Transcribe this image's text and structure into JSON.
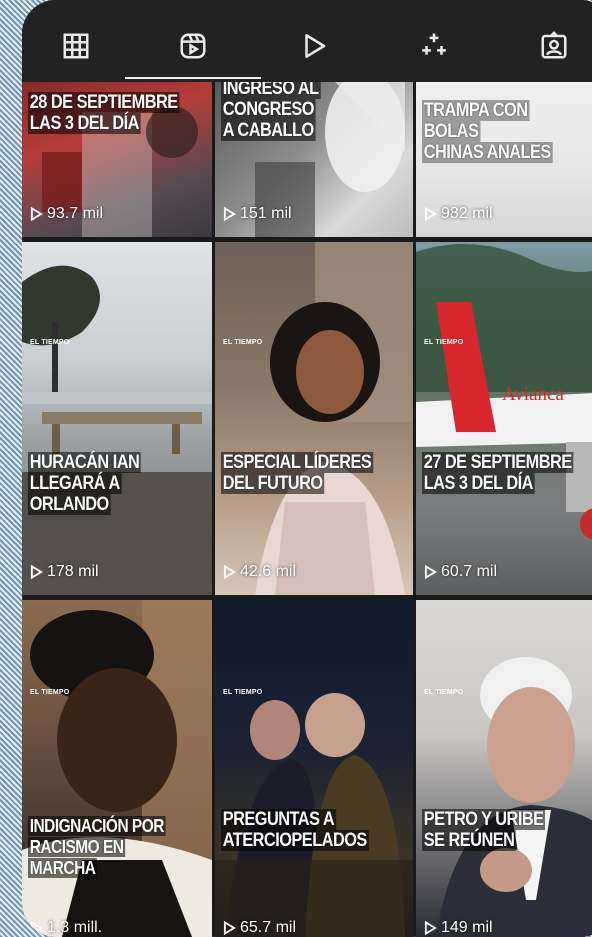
{
  "tabs": [
    {
      "name": "grid-icon"
    },
    {
      "name": "reels-icon",
      "active": true
    },
    {
      "name": "play-icon"
    },
    {
      "name": "sparkle-icon"
    },
    {
      "name": "tagged-icon"
    }
  ],
  "tiles": [
    {
      "brand": "",
      "caption": [
        "28 DE SEPTIEMBRE",
        "LAS 3 DEL DÍA"
      ],
      "views": "93.7 mil"
    },
    {
      "brand": "",
      "caption": [
        "INGRESO AL",
        "CONGRESO",
        "A CABALLO"
      ],
      "views": "151 mil"
    },
    {
      "brand": "",
      "caption": [
        "TRAMPA CON BOLAS",
        "CHINAS ANALES"
      ],
      "views": "982 mil"
    },
    {
      "brand": "EL TIEMPO",
      "caption": [
        "HURACÁN IAN",
        "LLEGARÁ A ORLANDO"
      ],
      "views": "178 mil"
    },
    {
      "brand": "EL TIEMPO",
      "caption": [
        "ESPECIAL LÍDERES",
        "DEL FUTURO"
      ],
      "views": "42.6 mil"
    },
    {
      "brand": "EL TIEMPO",
      "caption": [
        "27 DE SEPTIEMBRE",
        "LAS 3 DEL DÍA"
      ],
      "views": "60.7 mil"
    },
    {
      "brand": "EL TIEMPO",
      "caption": [
        "INDIGNACIÓN POR",
        "RACISMO EN MARCHA"
      ],
      "views": "1.3 mill."
    },
    {
      "brand": "EL TIEMPO",
      "caption": [
        "PREGUNTAS A",
        "ATERCIOPELADOS"
      ],
      "views": "65.7 mil"
    },
    {
      "brand": "EL TIEMPO",
      "caption": [
        "PETRO Y URIBE",
        "SE REÚNEN"
      ],
      "views": "149 mil"
    }
  ],
  "overlay_text": {
    "avianca": "Avianca"
  },
  "colors": {
    "tabbar_bg": "#222222",
    "frame_bg": "#1a1a1a",
    "accent_red": "#d7262e"
  }
}
